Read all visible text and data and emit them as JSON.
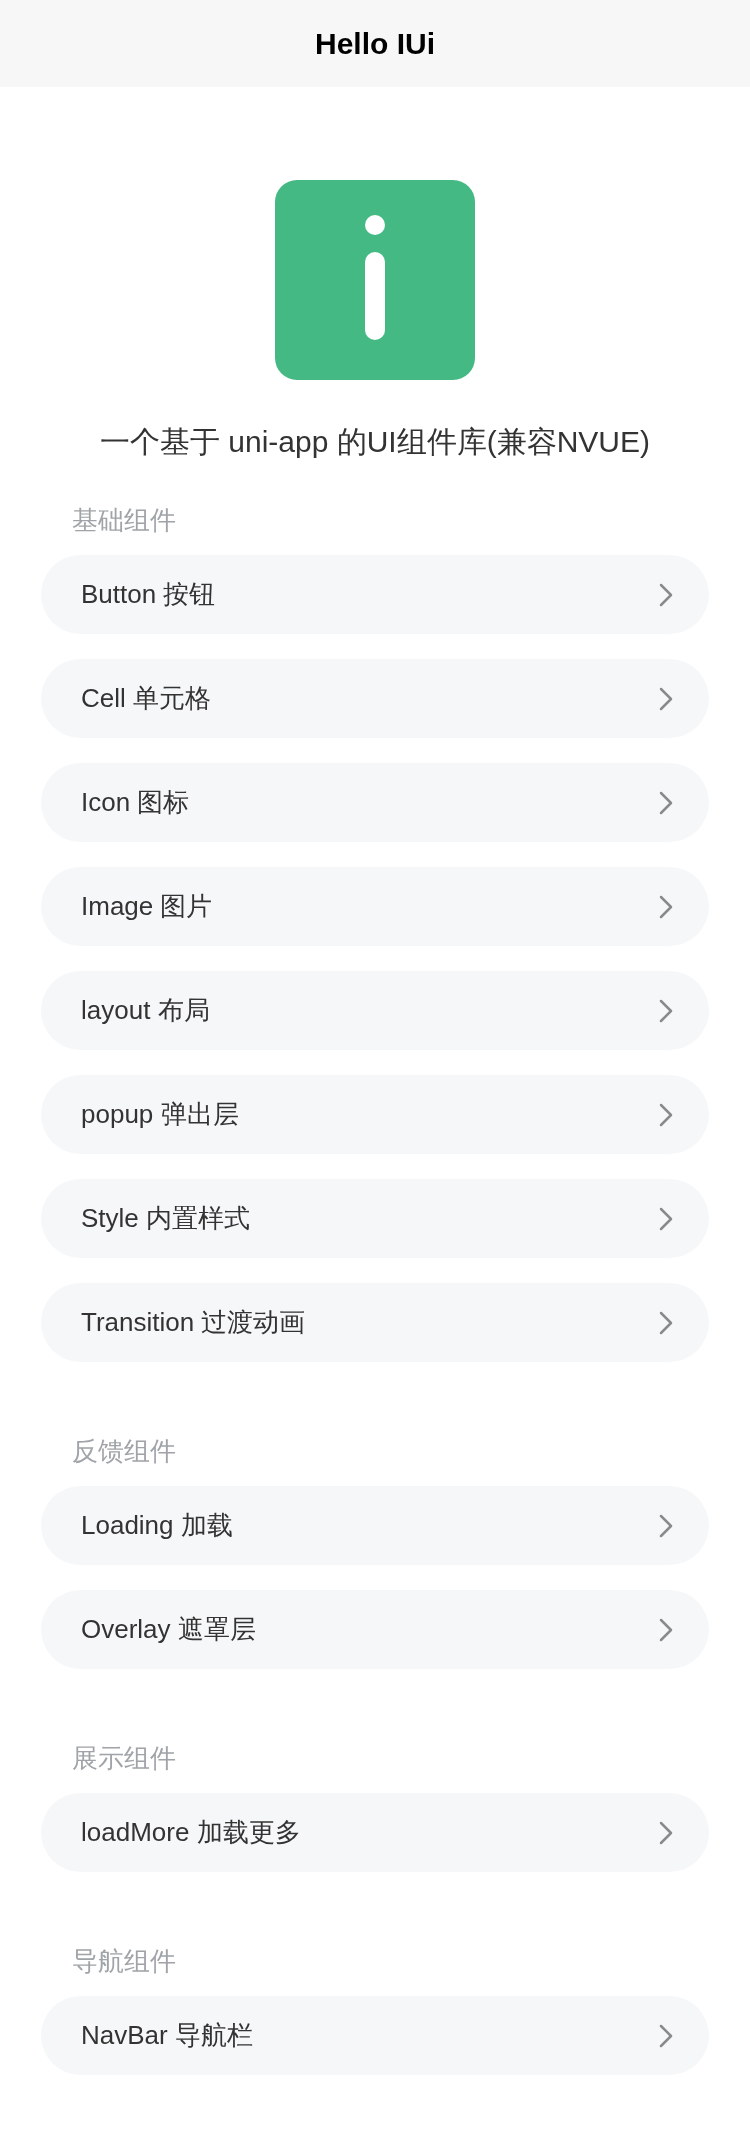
{
  "header": {
    "title": "Hello IUi"
  },
  "subtitle": "一个基于 uni-app 的UI组件库(兼容NVUE)",
  "sections": [
    {
      "title": "基础组件",
      "items": [
        "Button 按钮",
        "Cell 单元格",
        "Icon 图标",
        "Image 图片",
        "layout 布局",
        "popup 弹出层",
        "Style 内置样式",
        "Transition 过渡动画"
      ]
    },
    {
      "title": "反馈组件",
      "items": [
        "Loading 加载",
        "Overlay 遮罩层"
      ]
    },
    {
      "title": "展示组件",
      "items": [
        "loadMore 加载更多"
      ]
    },
    {
      "title": "导航组件",
      "items": [
        "NavBar 导航栏"
      ]
    }
  ]
}
